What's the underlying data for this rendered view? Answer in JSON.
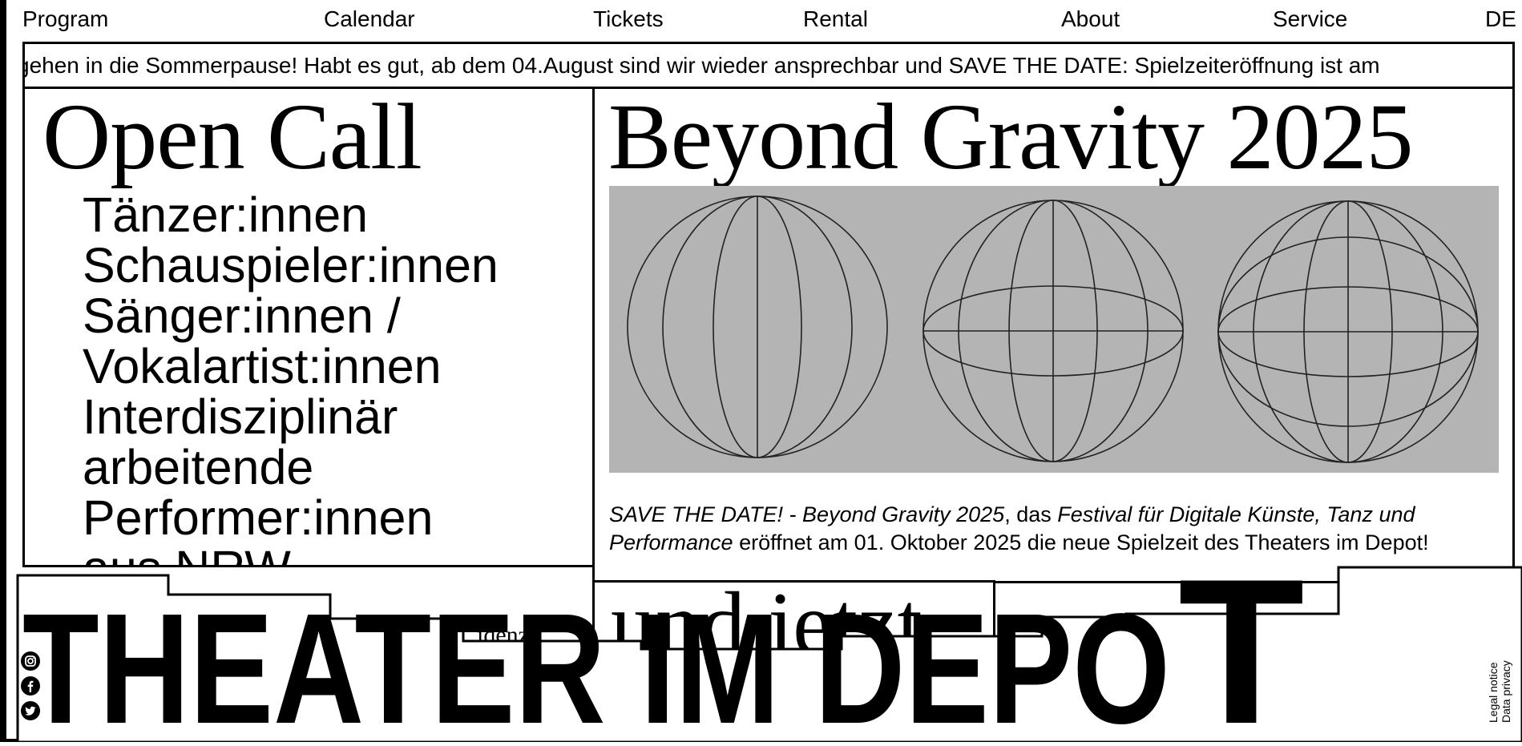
{
  "nav": {
    "items": [
      "Program",
      "Calendar",
      "Tickets",
      "Rental",
      "About",
      "Service"
    ],
    "language": "DE"
  },
  "ticker": {
    "text": "gehen in die Sommerpause! Habt es gut, ab dem 04.August sind wir wieder ansprechbar und SAVE THE DATE: Spielzeiteröffnung ist am"
  },
  "open_call": {
    "title": "Open Call",
    "items": [
      "Tänzer:innen",
      "Schauspieler:innen",
      "Sänger:innen /",
      "Vokalartist:innen",
      "Interdisziplinär",
      "arbeitende",
      "Performer:innen",
      "aus NRW"
    ],
    "overflow_text": "idenz"
  },
  "beyond": {
    "title": "Beyond Gravity 2025",
    "image_icons": [
      "globe-icon",
      "globe-icon",
      "globe-icon"
    ],
    "desc_italic_1": "SAVE THE DATE! - Beyond Gravity 2025",
    "desc_plain_1": ", das ",
    "desc_italic_2": "Festival für Digitale Künste, Tanz und Performance",
    "desc_plain_2": " eröffnet am 01. Oktober 2025 die neue Spielzeit des Theaters im Depot!"
  },
  "und_jetzt": {
    "title": "und jetzt"
  },
  "logo": {
    "text": "THEATER IM DEPOT"
  },
  "social": {
    "icons": [
      "instagram-icon",
      "facebook-icon",
      "twitter-icon"
    ]
  },
  "legal": {
    "legal_notice": "Legal notice",
    "data_privacy": "Data privacy"
  },
  "colors": {
    "background": "#ffffff",
    "ink": "#000000",
    "image_gray": "#b4b4b4"
  }
}
